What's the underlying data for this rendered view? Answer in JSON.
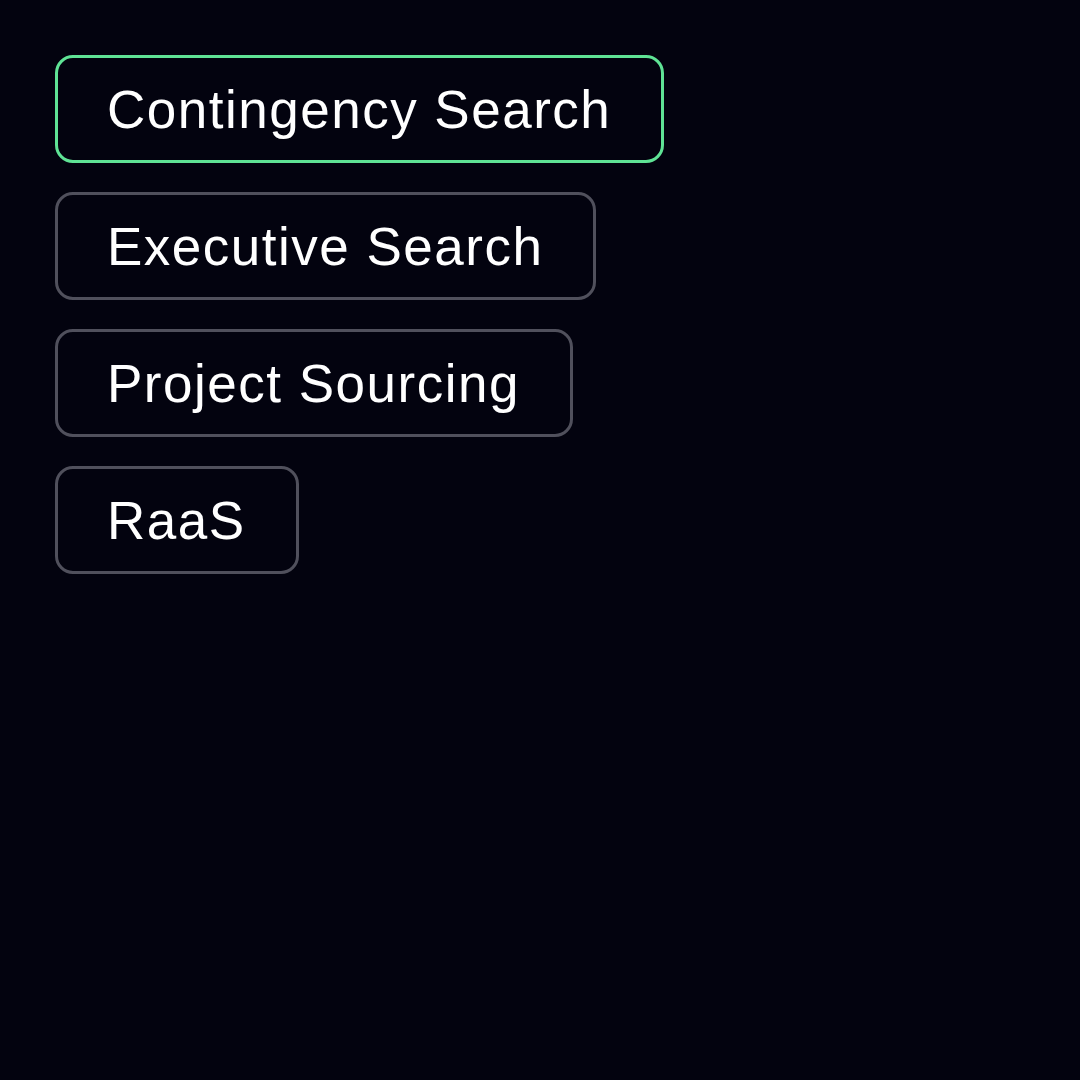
{
  "options": [
    {
      "label": "Contingency Search",
      "selected": true
    },
    {
      "label": "Executive Search",
      "selected": false
    },
    {
      "label": "Project Sourcing",
      "selected": false
    },
    {
      "label": "RaaS",
      "selected": false
    }
  ]
}
